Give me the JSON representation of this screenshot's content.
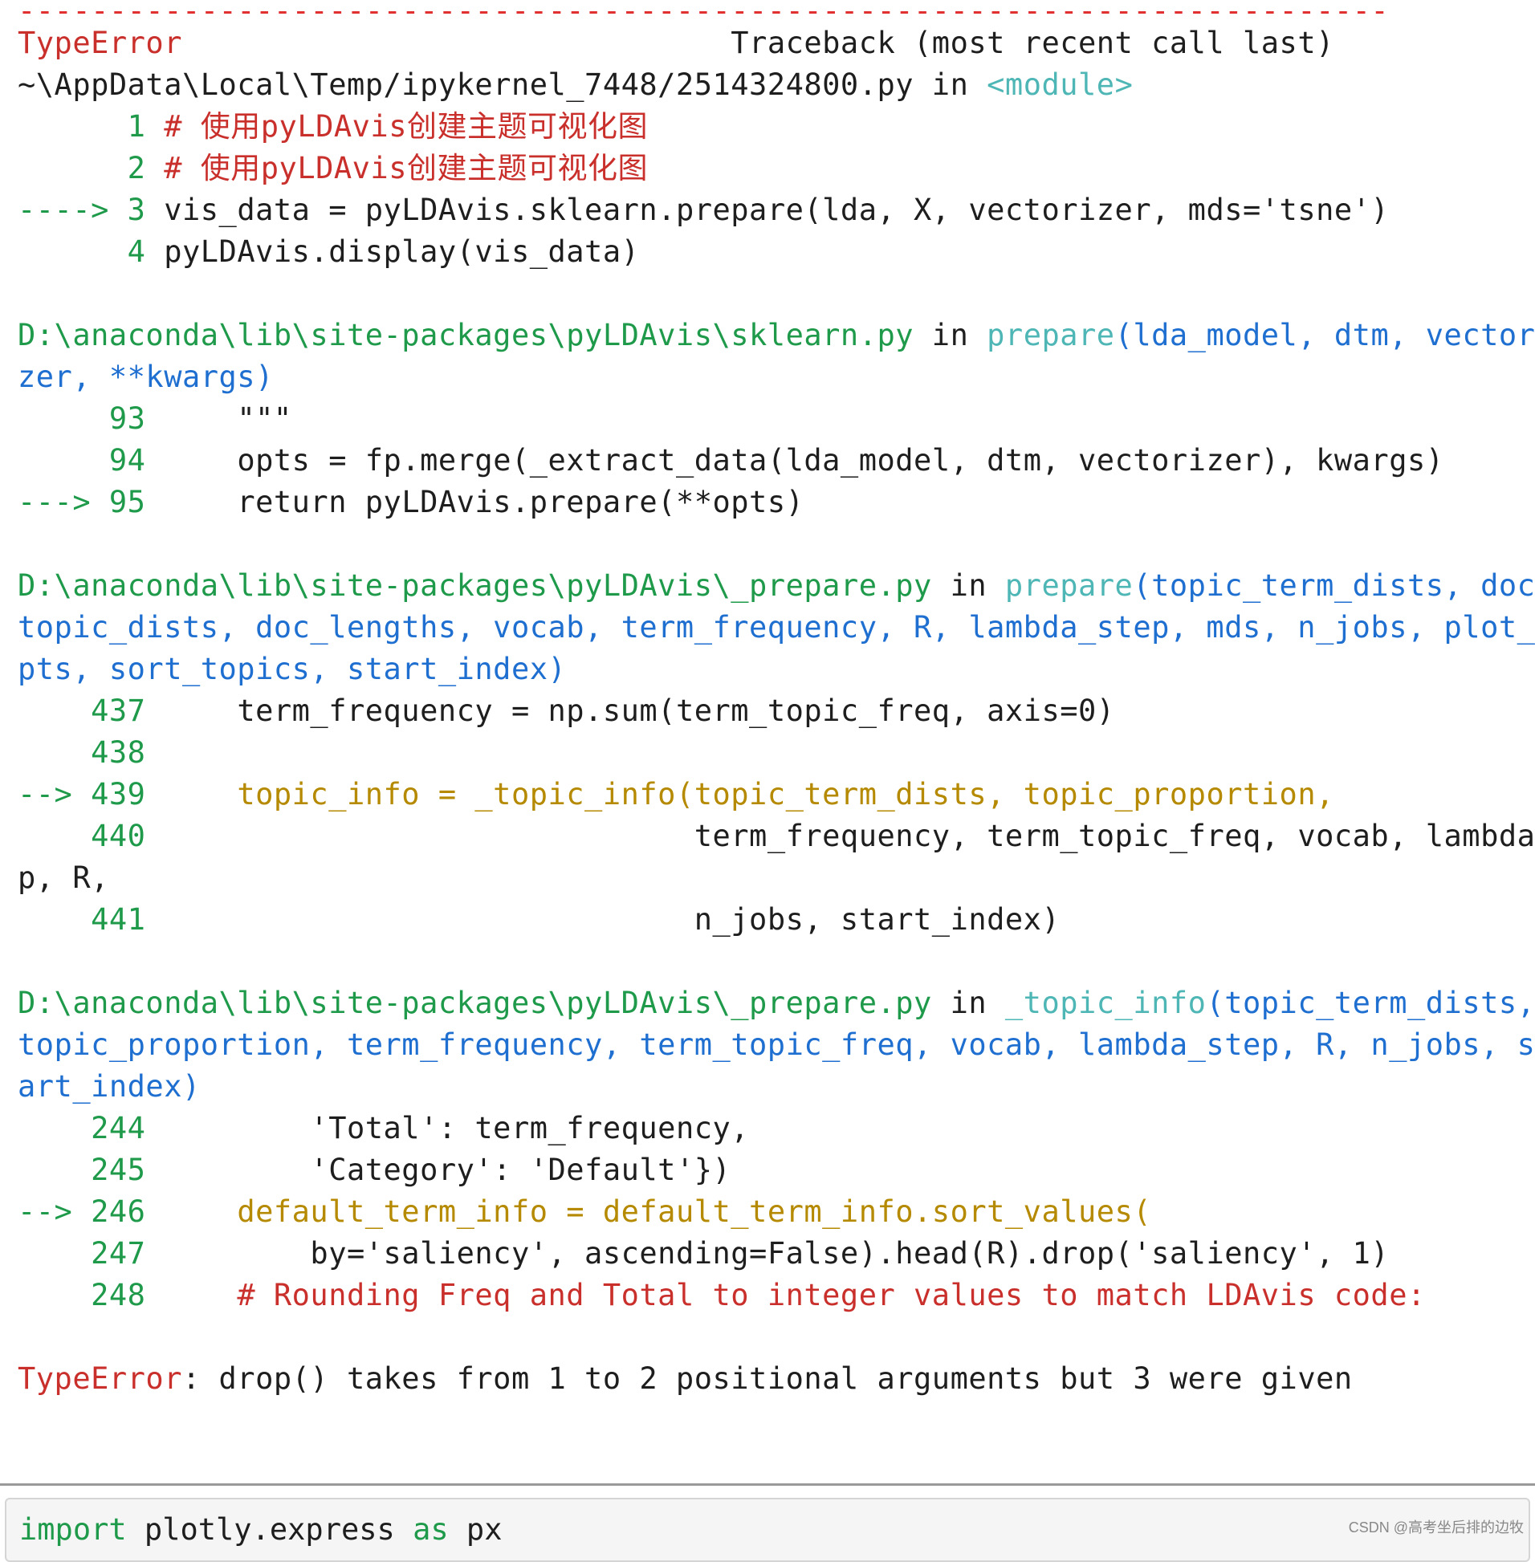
{
  "colors": {
    "error_red": "#c9302c",
    "line_number_green": "#1e9a4a",
    "function_cyan": "#4fb6b6",
    "argument_blue": "#1f6fd1",
    "highlight_gold": "#b58a00"
  },
  "traceback": {
    "separator": "---------------------------------------------------------------------------",
    "error_type": "TypeError",
    "header": "                              Traceback (most recent call last)",
    "frames": [
      {
        "file": "~\\AppData\\Local\\Temp/ipykernel_7448/2514324800.py",
        "in_text": " in ",
        "func": "<module>",
        "args_wrapped": [],
        "lines": [
          {
            "prefix": "      ",
            "num": "1",
            "code": " # 使用pyLDAvis创建主题可视化图"
          },
          {
            "prefix": "      ",
            "num": "2",
            "code": " # 使用pyLDAvis创建主题可视化图"
          },
          {
            "prefix": "----> ",
            "num": "3",
            "code": " vis_data = pyLDAvis.sklearn.prepare(lda, X, vectorizer, mds='tsne')"
          },
          {
            "prefix": "      ",
            "num": "4",
            "code": " pyLDAvis.display(vis_data)"
          }
        ]
      },
      {
        "file": "D:\\anaconda\\lib\\site-packages\\pyLDAvis\\sklearn.py",
        "in_text": " in ",
        "func": "prepare",
        "args_first": "(lda_model, dtm, vectori",
        "args_wrapped": [
          "zer, **kwargs)"
        ],
        "lines": [
          {
            "prefix": "     ",
            "num": "93",
            "code": "     \"\"\""
          },
          {
            "prefix": "     ",
            "num": "94",
            "code": "     opts = fp.merge(_extract_data(lda_model, dtm, vectorizer), kwargs)"
          },
          {
            "prefix": "---> ",
            "num": "95",
            "code": "     return pyLDAvis.prepare(**opts)"
          }
        ]
      },
      {
        "file": "D:\\anaconda\\lib\\site-packages\\pyLDAvis\\_prepare.py",
        "in_text": " in ",
        "func": "prepare",
        "args_first": "(topic_term_dists, doc_",
        "args_wrapped": [
          "topic_dists, doc_lengths, vocab, term_frequency, R, lambda_step, mds, n_jobs, plot_o",
          "pts, sort_topics, start_index)"
        ],
        "lines": [
          {
            "prefix": "    ",
            "num": "437",
            "code": "     term_frequency = np.sum(term_topic_freq, axis=0)"
          },
          {
            "prefix": "    ",
            "num": "438",
            "code": ""
          },
          {
            "prefix": "--> ",
            "num": "439",
            "code": "     topic_info = _topic_info(topic_term_dists, topic_proportion,"
          },
          {
            "prefix": "    ",
            "num": "440",
            "code": "                              term_frequency, term_topic_freq, vocab, lambda_ste"
          },
          {
            "prefix": "",
            "num": "",
            "code": "p, R,"
          },
          {
            "prefix": "    ",
            "num": "441",
            "code": "                              n_jobs, start_index)"
          }
        ]
      },
      {
        "file": "D:\\anaconda\\lib\\site-packages\\pyLDAvis\\_prepare.py",
        "in_text": " in ",
        "func": "_topic_info",
        "args_first": "(topic_term_dists,",
        "args_wrapped": [
          "topic_proportion, term_frequency, term_topic_freq, vocab, lambda_step, R, n_jobs, st",
          "art_index)"
        ],
        "lines": [
          {
            "prefix": "    ",
            "num": "244",
            "code": "         'Total': term_frequency,"
          },
          {
            "prefix": "    ",
            "num": "245",
            "code": "         'Category': 'Default'})"
          },
          {
            "prefix": "--> ",
            "num": "246",
            "code": "     default_term_info = default_term_info.sort_values("
          },
          {
            "prefix": "    ",
            "num": "247",
            "code": "         by='saliency', ascending=False).head(R).drop('saliency', 1)"
          },
          {
            "prefix": "    ",
            "num": "248",
            "code": "     # Rounding Freq and Total to integer values to match LDAvis code:"
          }
        ]
      }
    ],
    "error_message": ": drop() takes from 1 to 2 positional arguments but 3 were given"
  },
  "next_cell": {
    "keyword_import": "import",
    "module": " plotly.express ",
    "keyword_as": "as",
    "alias": " px"
  },
  "watermark": "CSDN @高考坐后排的边牧"
}
